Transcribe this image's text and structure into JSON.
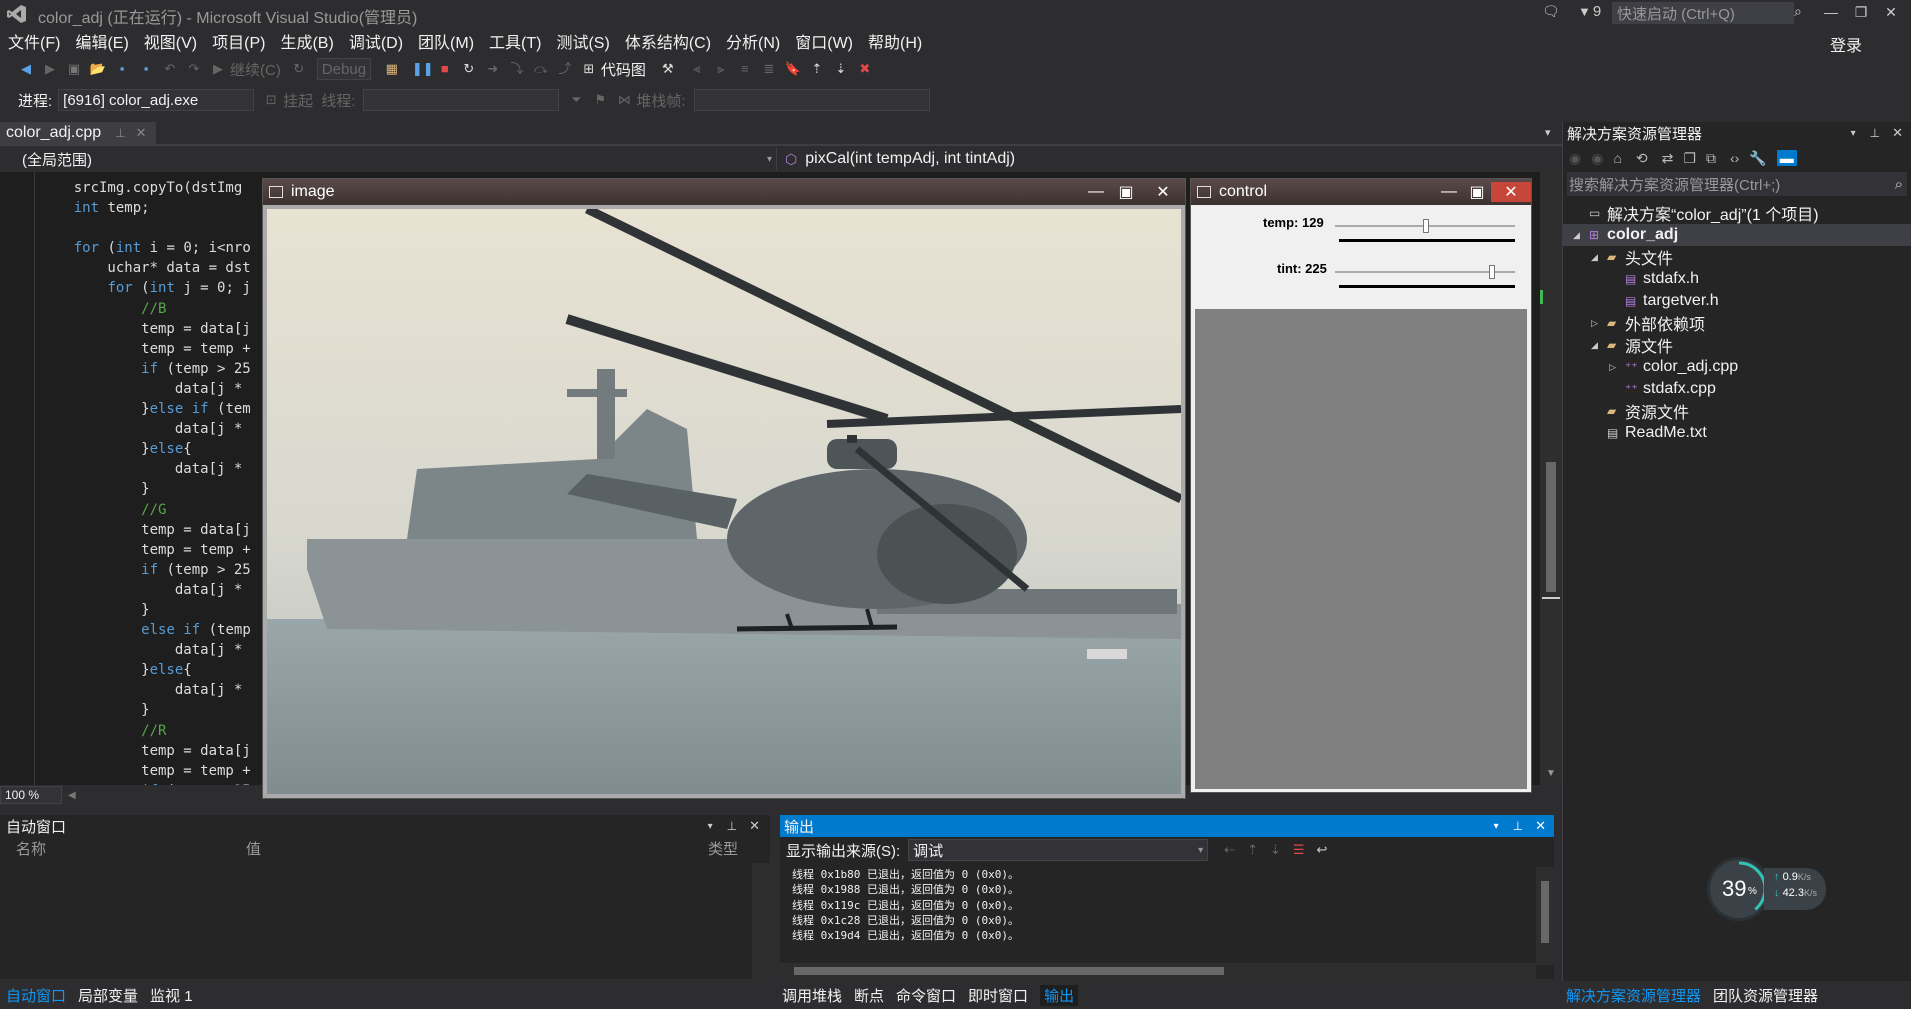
{
  "window": {
    "title": "color_adj (正在运行) - Microsoft Visual Studio(管理员)",
    "notification_count": "9",
    "quick_launch_placeholder": "快速启动 (Ctrl+Q)",
    "login": "登录"
  },
  "menu": [
    "文件(F)",
    "编辑(E)",
    "视图(V)",
    "项目(P)",
    "生成(B)",
    "调试(D)",
    "团队(M)",
    "工具(T)",
    "测试(S)",
    "体系结构(C)",
    "分析(N)",
    "窗口(W)",
    "帮助(H)"
  ],
  "toolbar": {
    "continue_label": "继续(C)",
    "config_value": "Debug",
    "code_map_label": "代码图",
    "process_label": "进程:",
    "process_value": "[6916] color_adj.exe",
    "suspend_label": "挂起",
    "thread_label": "线程:",
    "stack_label": "堆栈帧:"
  },
  "editor": {
    "tab_name": "color_adj.cpp",
    "scope": "(全局范围)",
    "function": "pixCal(int tempAdj, int tintAdj)",
    "zoom": "100 %",
    "lines": [
      [
        {
          "t": "    srcImg.copyTo(dstImg"
        }
      ],
      [
        {
          "t": "    ",
          "c": ""
        },
        {
          "t": "int",
          "c": "kw"
        },
        {
          "t": " temp;"
        }
      ],
      [
        {
          "t": ""
        }
      ],
      [
        {
          "t": "    "
        },
        {
          "t": "for",
          "c": "kw"
        },
        {
          "t": " ("
        },
        {
          "t": "int",
          "c": "kw"
        },
        {
          "t": " i = 0; i<nro"
        }
      ],
      [
        {
          "t": "        uchar* data = dst"
        }
      ],
      [
        {
          "t": "        "
        },
        {
          "t": "for",
          "c": "kw"
        },
        {
          "t": " ("
        },
        {
          "t": "int",
          "c": "kw"
        },
        {
          "t": " j = 0; j"
        }
      ],
      [
        {
          "t": "            "
        },
        {
          "t": "//B",
          "c": "cm"
        }
      ],
      [
        {
          "t": "            temp = data[j"
        }
      ],
      [
        {
          "t": "            temp = temp +"
        }
      ],
      [
        {
          "t": "            "
        },
        {
          "t": "if",
          "c": "kw"
        },
        {
          "t": " (temp > 25"
        }
      ],
      [
        {
          "t": "                data[j * "
        }
      ],
      [
        {
          "t": "            }"
        },
        {
          "t": "else if",
          "c": "kw"
        },
        {
          "t": " (tem"
        }
      ],
      [
        {
          "t": "                data[j * "
        }
      ],
      [
        {
          "t": "            }"
        },
        {
          "t": "else",
          "c": "kw"
        },
        {
          "t": "{"
        }
      ],
      [
        {
          "t": "                data[j * "
        }
      ],
      [
        {
          "t": "            }"
        }
      ],
      [
        {
          "t": "            "
        },
        {
          "t": "//G",
          "c": "cm"
        }
      ],
      [
        {
          "t": "            temp = data[j"
        }
      ],
      [
        {
          "t": "            temp = temp +"
        }
      ],
      [
        {
          "t": "            "
        },
        {
          "t": "if",
          "c": "kw"
        },
        {
          "t": " (temp > 25"
        }
      ],
      [
        {
          "t": "                data[j * "
        }
      ],
      [
        {
          "t": "            }"
        }
      ],
      [
        {
          "t": "            "
        },
        {
          "t": "else if",
          "c": "kw"
        },
        {
          "t": " (temp"
        }
      ],
      [
        {
          "t": "                data[j * "
        }
      ],
      [
        {
          "t": "            }"
        },
        {
          "t": "else",
          "c": "kw"
        },
        {
          "t": "{"
        }
      ],
      [
        {
          "t": "                data[j * "
        }
      ],
      [
        {
          "t": "            }"
        }
      ],
      [
        {
          "t": "            "
        },
        {
          "t": "//R",
          "c": "cm"
        }
      ],
      [
        {
          "t": "            temp = data[j"
        }
      ],
      [
        {
          "t": "            temp = temp +"
        }
      ],
      [
        {
          "t": "            "
        },
        {
          "t": "if",
          "c": "kw"
        },
        {
          "t": " (temp > 25"
        }
      ]
    ]
  },
  "image_window": {
    "title": "image"
  },
  "control_window": {
    "title": "control",
    "temp_label": "temp: 129",
    "temp_value": 129,
    "temp_max": 255,
    "tint_label": "tint: 225",
    "tint_value": 225,
    "tint_max": 255
  },
  "solution_explorer": {
    "title": "解决方案资源管理器",
    "search_placeholder": "搜索解决方案资源管理器(Ctrl+;)",
    "items": [
      {
        "label": "解决方案“color_adj”(1 个项目)",
        "indent": 0,
        "arrow": "",
        "icon": "solution-icon",
        "bold": false
      },
      {
        "label": "color_adj",
        "indent": 0,
        "arrow": "◢",
        "icon": "project-icon",
        "bold": true
      },
      {
        "label": "头文件",
        "indent": 1,
        "arrow": "◢",
        "icon": "folder-icon",
        "bold": false
      },
      {
        "label": "stdafx.h",
        "indent": 2,
        "arrow": "",
        "icon": "header-file-icon",
        "bold": false
      },
      {
        "label": "targetver.h",
        "indent": 2,
        "arrow": "",
        "icon": "header-file-icon",
        "bold": false
      },
      {
        "label": "外部依赖项",
        "indent": 1,
        "arrow": "▷",
        "icon": "folder-icon",
        "bold": false
      },
      {
        "label": "源文件",
        "indent": 1,
        "arrow": "◢",
        "icon": "folder-icon",
        "bold": false
      },
      {
        "label": "color_adj.cpp",
        "indent": 2,
        "arrow": "▷",
        "icon": "cpp-file-icon",
        "bold": false
      },
      {
        "label": "stdafx.cpp",
        "indent": 2,
        "arrow": "",
        "icon": "cpp-file-icon",
        "bold": false
      },
      {
        "label": "资源文件",
        "indent": 1,
        "arrow": "",
        "icon": "folder-icon",
        "bold": false
      },
      {
        "label": "ReadMe.txt",
        "indent": 1,
        "arrow": "",
        "icon": "text-file-icon",
        "bold": false
      }
    ],
    "tabs": [
      "解决方案资源管理器",
      "团队资源管理器"
    ]
  },
  "auto_window": {
    "title": "自动窗口",
    "columns": [
      "名称",
      "值",
      "类型"
    ],
    "tabs": [
      "自动窗口",
      "局部变量",
      "监视 1"
    ]
  },
  "output_window": {
    "title": "输出",
    "source_label": "显示输出来源(S):",
    "source_value": "调试",
    "lines": [
      "线程 0x1b80 已退出，返回值为 0 (0x0)。",
      "线程 0x1988 已退出，返回值为 0 (0x0)。",
      "线程 0x119c 已退出，返回值为 0 (0x0)。",
      "线程 0x1c28 已退出，返回值为 0 (0x0)。",
      "线程 0x19d4 已退出，返回值为 0 (0x0)。"
    ],
    "tabs": [
      "调用堆栈",
      "断点",
      "命令窗口",
      "即时窗口",
      "输出"
    ]
  },
  "network_widget": {
    "percent": "39",
    "percent_unit": "%",
    "upload": "0.9",
    "download": "42.3",
    "unit": "K/s"
  },
  "colors": {
    "accent": "#007acc",
    "bg": "#2d2d30",
    "editor_bg": "#1e1e1e",
    "keyword": "#569cd6",
    "comment": "#57a64a"
  }
}
